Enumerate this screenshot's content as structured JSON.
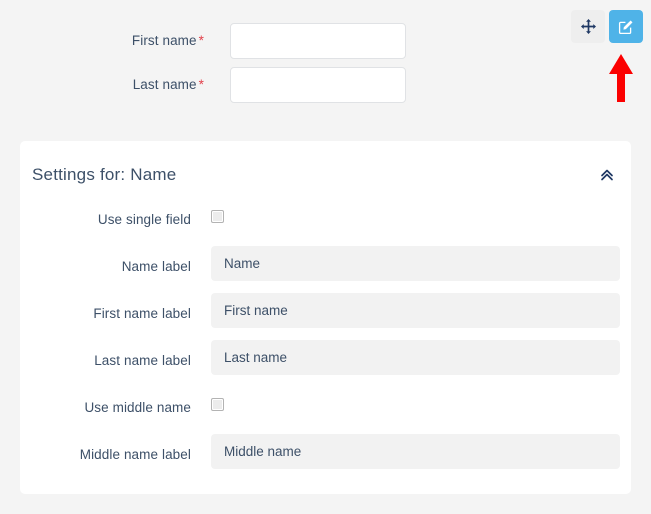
{
  "form_preview": {
    "fields": [
      {
        "label": "First name",
        "required_marker": "*",
        "value": "",
        "placeholder": ""
      },
      {
        "label": "Last name",
        "required_marker": "*",
        "value": "",
        "placeholder": ""
      }
    ]
  },
  "toolbar": {
    "move_icon": "move-arrows-icon",
    "edit_icon": "pencil-square-icon",
    "edit_button_color": "#4fb3e8",
    "move_button_color": "#eeeeee"
  },
  "annotation": {
    "arrow_icon": "arrow-up-icon",
    "color": "#fb0000"
  },
  "settings_panel": {
    "title": "Settings for: Name",
    "collapse_icon": "chevron-double-up-icon",
    "rows": [
      {
        "label": "Use single field",
        "type": "checkbox",
        "checked": false
      },
      {
        "label": "Name label",
        "type": "text",
        "value": "Name"
      },
      {
        "label": "First name label",
        "type": "text",
        "value": "First name"
      },
      {
        "label": "Last name label",
        "type": "text",
        "value": "Last name"
      },
      {
        "label": "Use middle name",
        "type": "checkbox",
        "checked": false
      },
      {
        "label": "Middle name label",
        "type": "text",
        "value": "Middle name"
      }
    ]
  },
  "colors": {
    "page_background": "#f4f4f4",
    "panel_background": "#ffffff",
    "text": "#3d5068",
    "required_star": "#e2404a",
    "input_field": "#f2f2f2"
  }
}
